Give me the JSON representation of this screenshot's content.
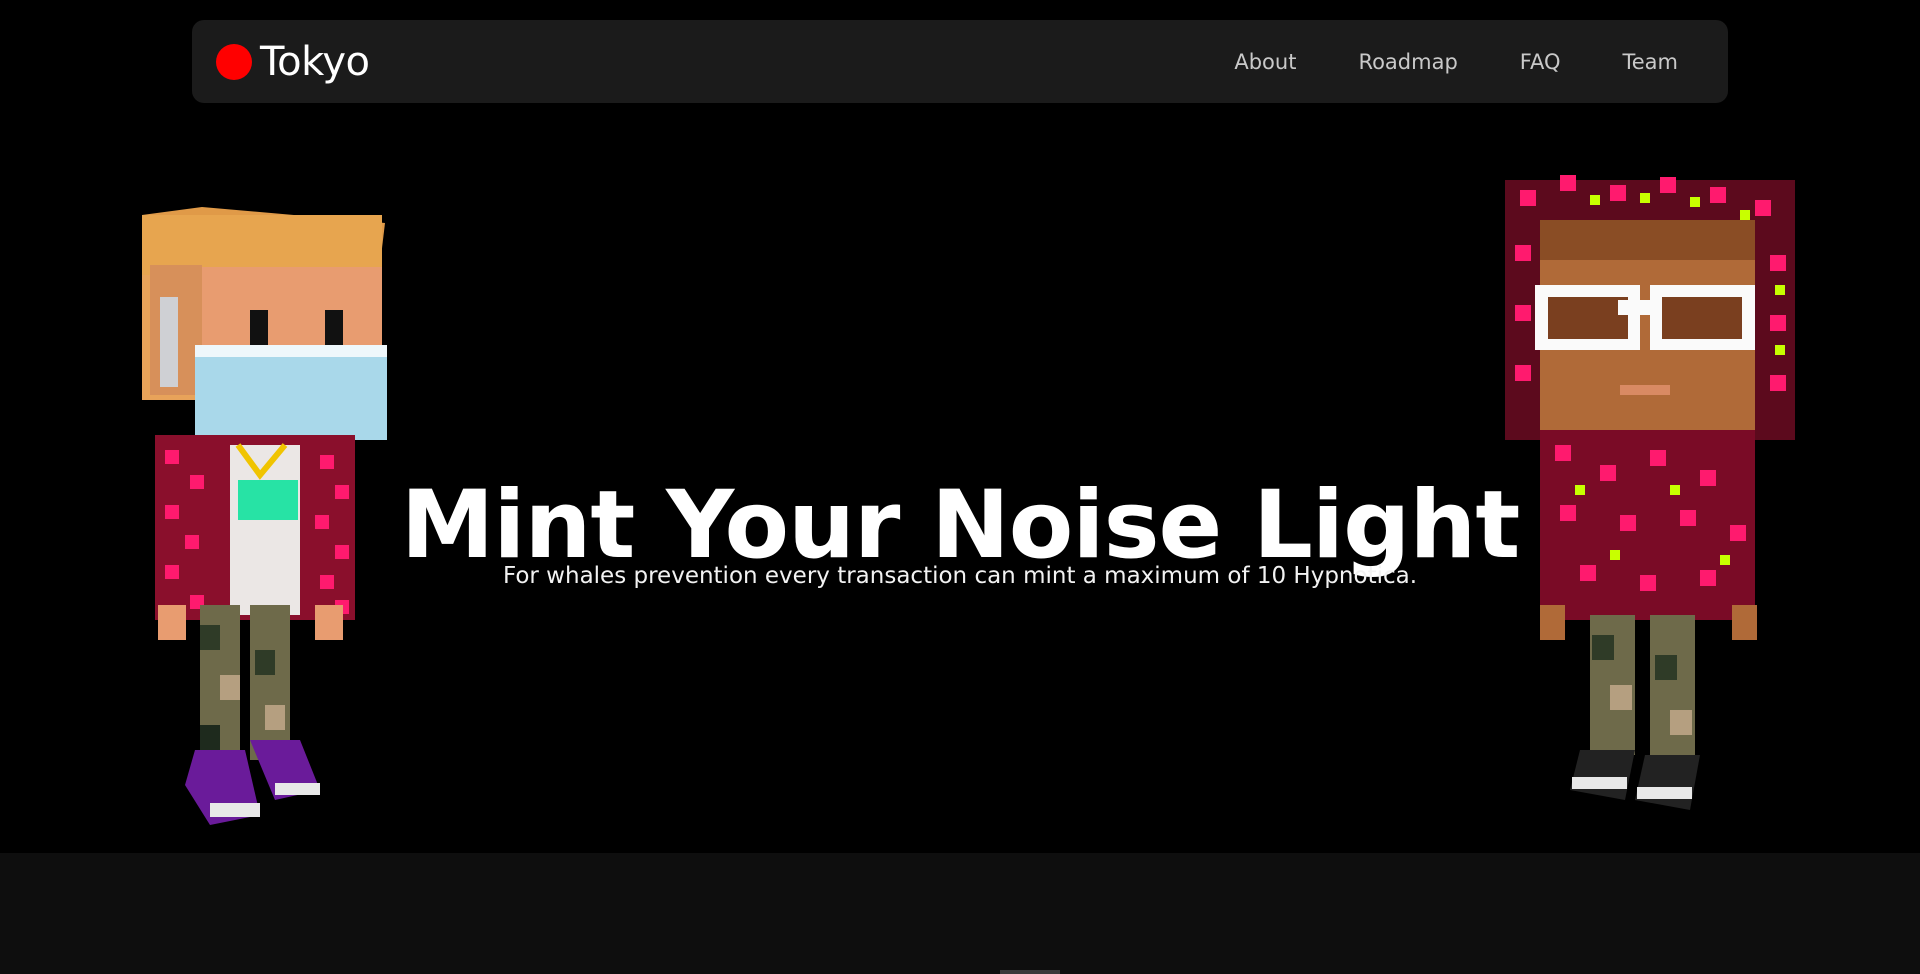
{
  "navbar": {
    "brand": "Tokyo",
    "brand_icon": "red-dot-logo-icon",
    "brand_color": "#ff0000",
    "links": [
      {
        "label": "About"
      },
      {
        "label": "Roadmap"
      },
      {
        "label": "FAQ"
      },
      {
        "label": "Team"
      }
    ]
  },
  "hero": {
    "title": "Mint Your Noise Light",
    "subtitle": "For whales prevention every transaction can mint a maximum of 10 Hypnotica."
  },
  "characters": {
    "left": "voxel-character-masked",
    "right": "voxel-character-hooded"
  },
  "colors": {
    "background": "#000000",
    "navbar": "#1b1b1b",
    "pink_pattern": "#ff1a6e",
    "lime_dots": "#c8ff00"
  }
}
